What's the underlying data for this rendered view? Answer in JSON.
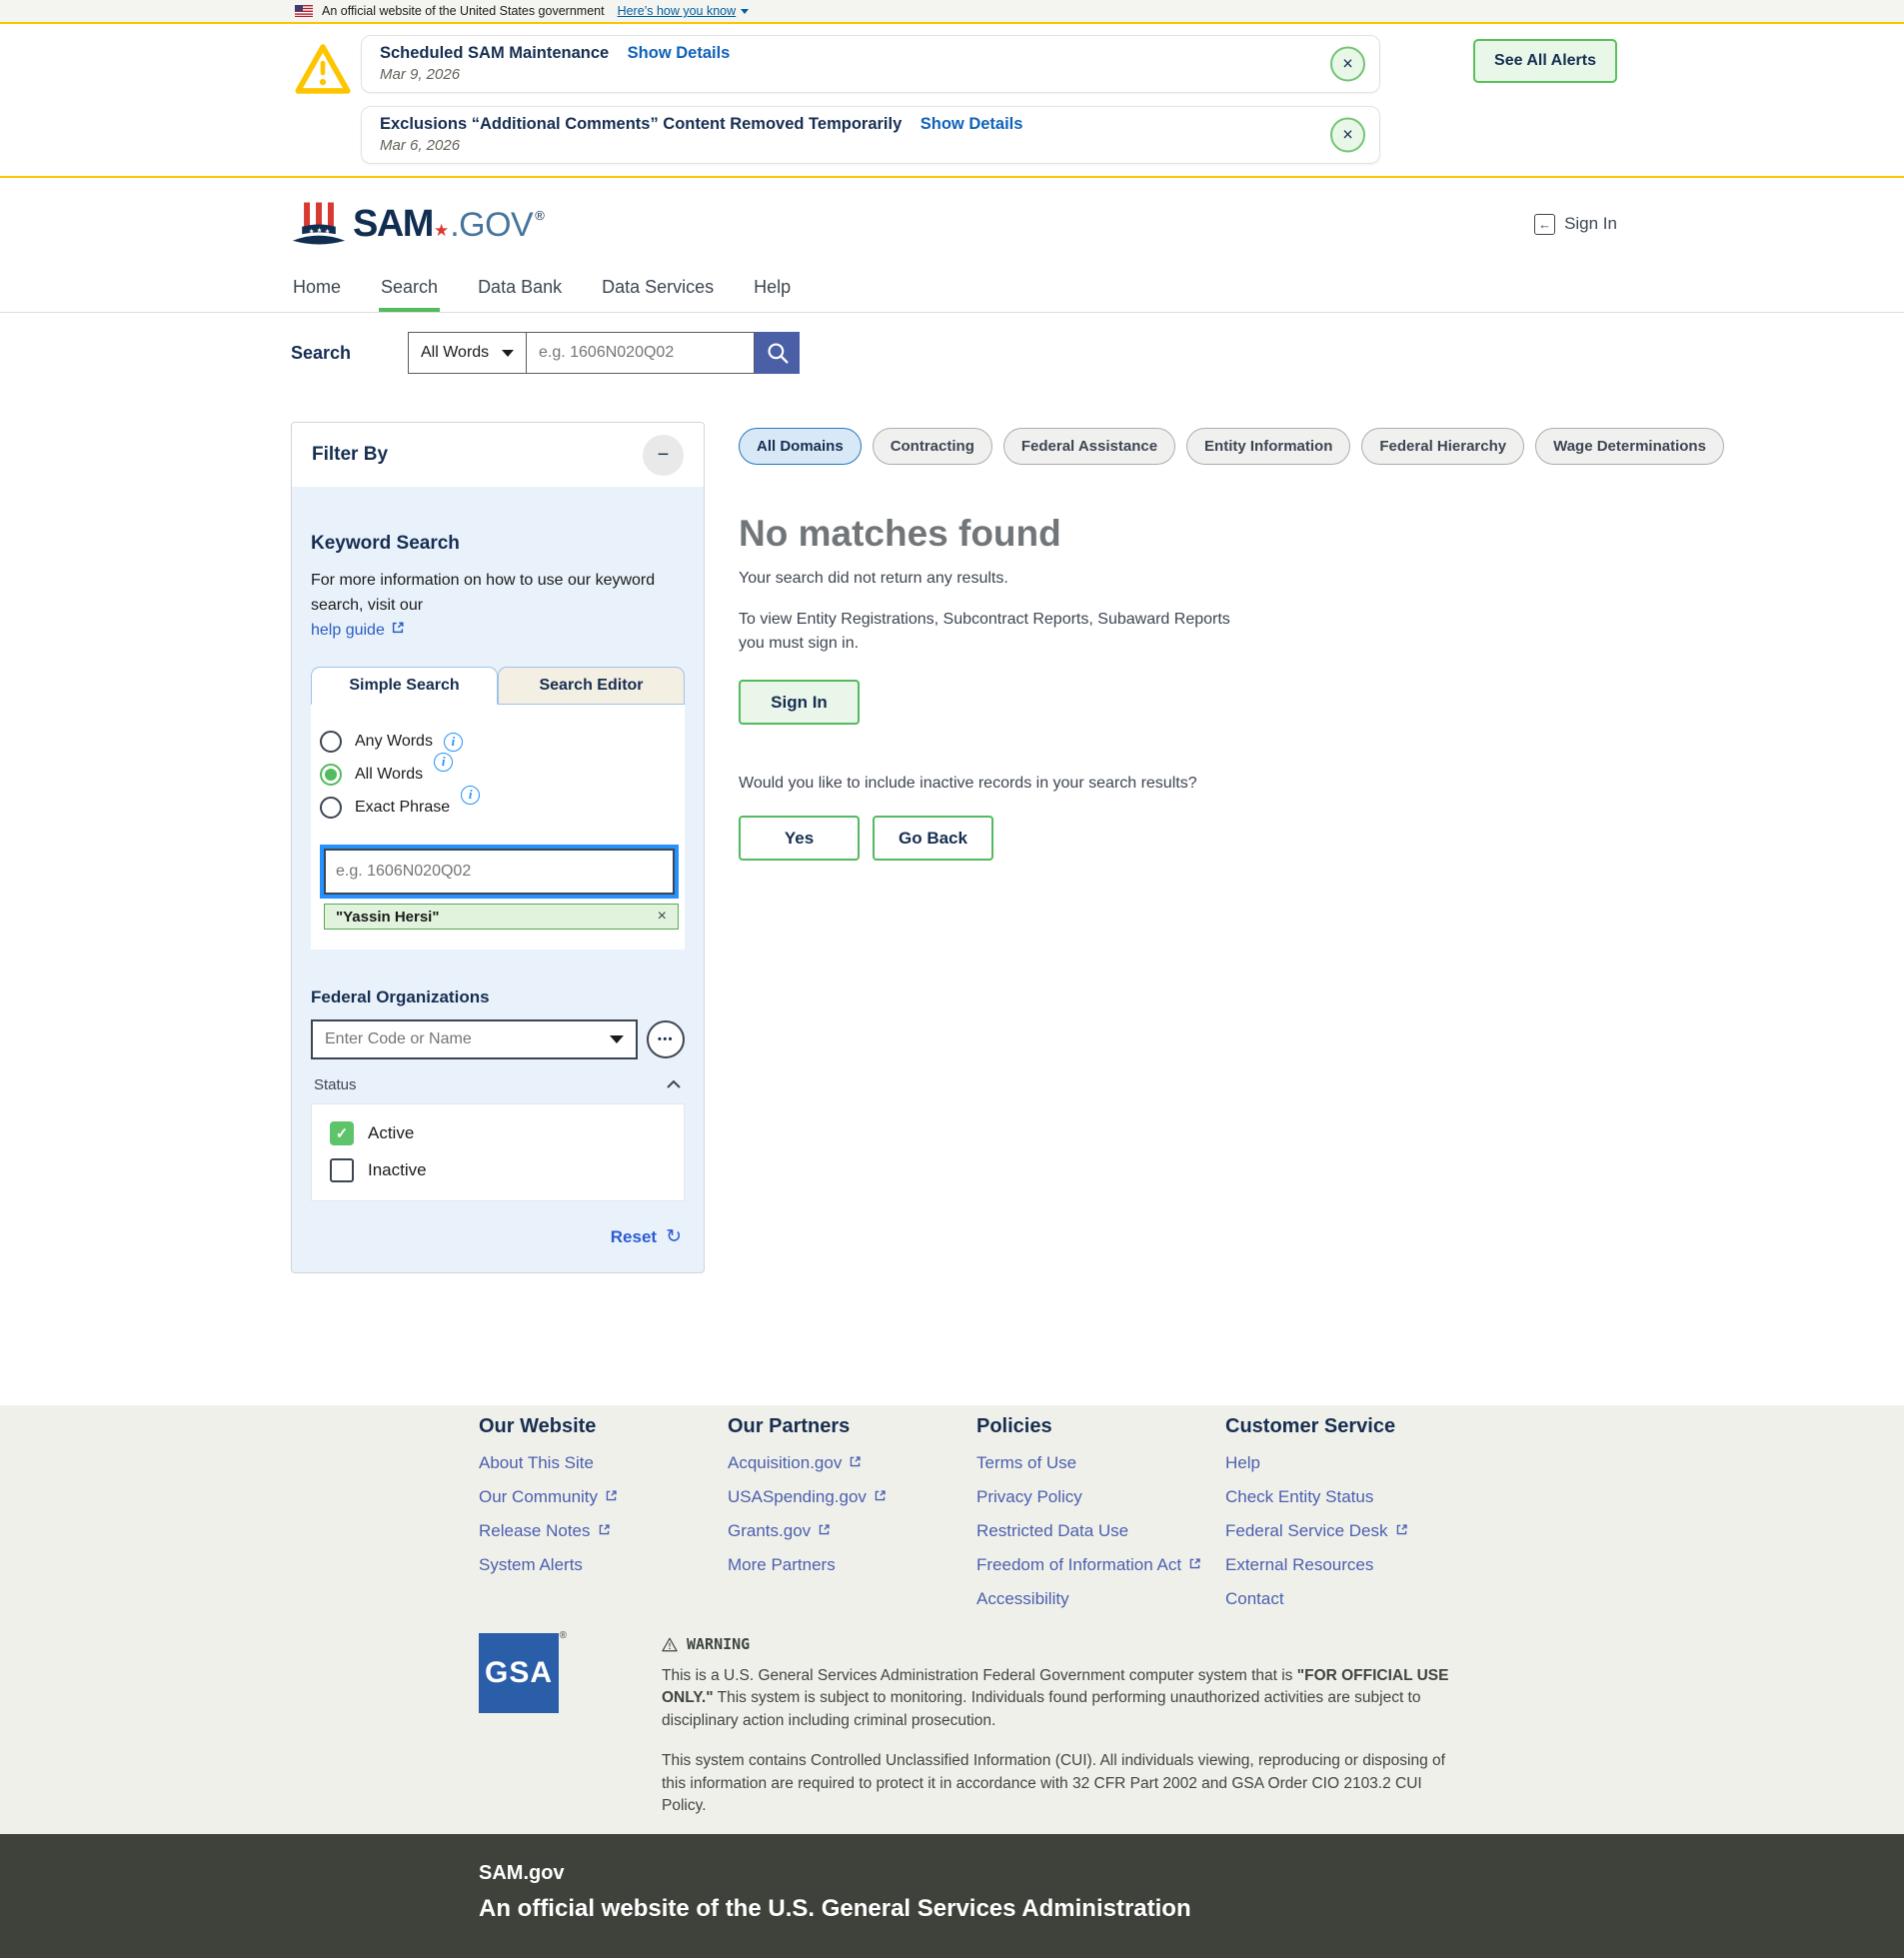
{
  "gov_banner": {
    "text": "An official website of the United States government",
    "link": "Here’s how you know"
  },
  "alerts": {
    "items": [
      {
        "title": "Scheduled SAM Maintenance",
        "details_label": "Show Details",
        "date": "Mar 9, 2026"
      },
      {
        "title": "Exclusions “Additional Comments” Content Removed Temporarily",
        "details_label": "Show Details",
        "date": "Mar 6, 2026"
      }
    ],
    "close_label": "×",
    "see_all_label": "See All Alerts"
  },
  "header": {
    "logo_sam": "SAM",
    "logo_star": "★",
    "logo_gov": ".GOV",
    "logo_reg": "®",
    "sign_in": "Sign In",
    "sign_in_icon": "←"
  },
  "nav": {
    "items": [
      {
        "label": "Home"
      },
      {
        "label": "Search",
        "active": true
      },
      {
        "label": "Data Bank"
      },
      {
        "label": "Data Services"
      },
      {
        "label": "Help"
      }
    ]
  },
  "searchbar": {
    "label": "Search",
    "scope_value": "All Words",
    "placeholder": "e.g. 1606N020Q02"
  },
  "filter": {
    "title": "Filter By",
    "collapse_glyph": "−",
    "keyword": {
      "heading": "Keyword Search",
      "info_text": "For more information on how to use our keyword search, visit our",
      "help_link": "help guide",
      "tabs": [
        {
          "label": "Simple Search",
          "active": true
        },
        {
          "label": "Search Editor",
          "active": false
        }
      ],
      "radios": [
        {
          "label": "Any Words",
          "checked": false
        },
        {
          "label": "All Words",
          "checked": true
        },
        {
          "label": "Exact Phrase",
          "checked": false
        }
      ],
      "info_glyph": "i",
      "input_placeholder": "e.g. 1606N020Q02",
      "chip": "\"Yassin Hersi\"",
      "chip_remove": "×"
    },
    "fed_org": {
      "heading": "Federal Organizations",
      "placeholder": "Enter Code or Name",
      "more_glyph": "•••"
    },
    "status": {
      "label": "Status",
      "options": [
        {
          "label": "Active",
          "checked": true
        },
        {
          "label": "Inactive",
          "checked": false
        }
      ],
      "check_glyph": "✓"
    },
    "reset_label": "Reset",
    "reset_glyph": "↻"
  },
  "results": {
    "domains": [
      {
        "label": "All Domains",
        "active": true
      },
      {
        "label": "Contracting",
        "active": false
      },
      {
        "label": "Federal Assistance",
        "active": false
      },
      {
        "label": "Entity Information",
        "active": false
      },
      {
        "label": "Federal Hierarchy",
        "active": false
      },
      {
        "label": "Wage Determinations",
        "active": false
      }
    ],
    "heading": "No matches found",
    "message1": "Your search did not return any results.",
    "message2": "To view Entity Registrations, Subcontract Reports, Subaward Reports you must sign in.",
    "sign_in_label": "Sign In",
    "question": "Would you like to include inactive records in your search results?",
    "yes_label": "Yes",
    "go_back_label": "Go Back"
  },
  "footer": {
    "columns": [
      {
        "heading": "Our Website",
        "links": [
          {
            "label": "About This Site",
            "external": false
          },
          {
            "label": "Our Community",
            "external": true
          },
          {
            "label": "Release Notes",
            "external": true
          },
          {
            "label": "System Alerts",
            "external": false
          }
        ]
      },
      {
        "heading": "Our Partners",
        "links": [
          {
            "label": "Acquisition.gov",
            "external": true
          },
          {
            "label": "USASpending.gov",
            "external": true
          },
          {
            "label": "Grants.gov",
            "external": true
          },
          {
            "label": "More Partners",
            "external": false
          }
        ]
      },
      {
        "heading": "Policies",
        "links": [
          {
            "label": "Terms of Use",
            "external": false
          },
          {
            "label": "Privacy Policy",
            "external": false
          },
          {
            "label": "Restricted Data Use",
            "external": false
          },
          {
            "label": "Freedom of Information Act",
            "external": true
          },
          {
            "label": "Accessibility",
            "external": false
          }
        ]
      },
      {
        "heading": "Customer Service",
        "links": [
          {
            "label": "Help",
            "external": false
          },
          {
            "label": "Check Entity Status",
            "external": false
          },
          {
            "label": "Federal Service Desk",
            "external": true
          },
          {
            "label": "External Resources",
            "external": false
          },
          {
            "label": "Contact",
            "external": false
          }
        ]
      }
    ]
  },
  "warning": {
    "gsa": "GSA",
    "gsa_reg": "®",
    "title": "WARNING",
    "p1_before": "This is a U.S. General Services Administration Federal Government computer system that is ",
    "p1_bold": "\"FOR OFFICIAL USE ONLY.\"",
    "p1_after": " This system is subject to monitoring. Individuals found performing unauthorized activities are subject to disciplinary action including criminal prosecution.",
    "p2": "This system contains Controlled Unclassified Information (CUI). All individuals viewing, reproducing or disposing of this information are required to protect it in accordance with 32 CFR Part 2002 and GSA Order CIO 2103.2 CUI Policy."
  },
  "bottom": {
    "site": "SAM.gov",
    "tagline": "An official website of the U.S. General Services Administration"
  },
  "colors": {
    "accent_green": "#52ba5f",
    "gold": "#fdc500",
    "navy": "#162e51",
    "link_blue": "#005ea2",
    "footer_link": "#4a5fae",
    "search_button": "#4a5fa5",
    "focus_ring": "#2491ff",
    "panel_bg": "#e9f2fb",
    "footer_bg": "#f0f0eb",
    "dark_footer_bg": "#3f423b"
  }
}
